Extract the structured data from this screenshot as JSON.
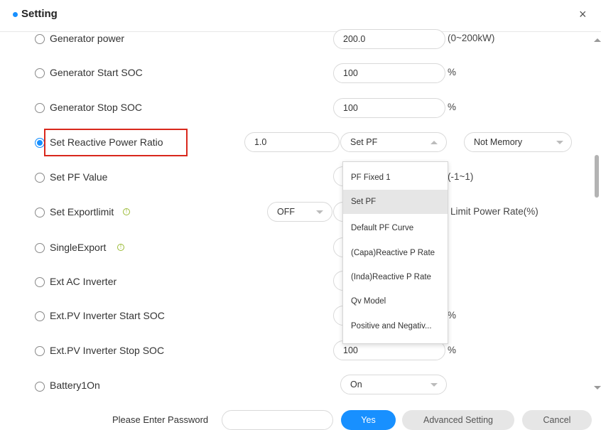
{
  "header": {
    "title": "Setting",
    "close_glyph": "×"
  },
  "rows": {
    "generator_power": {
      "label": "Generator power",
      "value": "200.0",
      "unit": "(0~200kW)"
    },
    "gen_start_soc": {
      "label": "Generator Start SOC",
      "value": "100",
      "unit": "%"
    },
    "gen_stop_soc": {
      "label": "Generator Stop SOC",
      "value": "100",
      "unit": "%"
    },
    "reactive_ratio": {
      "label": "Set Reactive Power Ratio",
      "value": "1.0",
      "mode": "Set PF",
      "memory": "Not Memory"
    },
    "pf_value": {
      "label": "Set PF Value",
      "unit": "(-1~1)"
    },
    "exportlimit": {
      "label": "Set Exportlimit",
      "select": "OFF",
      "unit": "Limit Power Rate(%)"
    },
    "single_export": {
      "label": "SingleExport"
    },
    "ext_ac": {
      "label": "Ext AC Inverter"
    },
    "ext_pv_start": {
      "label": "Ext.PV Inverter Start SOC",
      "unit": "%"
    },
    "ext_pv_stop": {
      "label": "Ext.PV Inverter Stop SOC",
      "value": "100",
      "unit": "%"
    },
    "battery1on": {
      "label": "Battery1On",
      "select": "On"
    }
  },
  "dropdown": {
    "items": [
      "PF Fixed 1",
      "Set PF",
      "Default PF Curve",
      "(Capa)Reactive P Rate",
      "(Inda)Reactive P Rate",
      "Qv Model",
      "Positive and Negativ..."
    ],
    "selected": "Set PF"
  },
  "footer": {
    "password_label": "Please Enter Password",
    "password_value": "",
    "yes": "Yes",
    "advanced": "Advanced Setting",
    "cancel": "Cancel"
  },
  "colors": {
    "accent": "#1890ff",
    "highlight": "#d9281c",
    "info": "#9bbb37"
  },
  "icons": {
    "info": "info-circle-icon",
    "close": "close-icon"
  }
}
